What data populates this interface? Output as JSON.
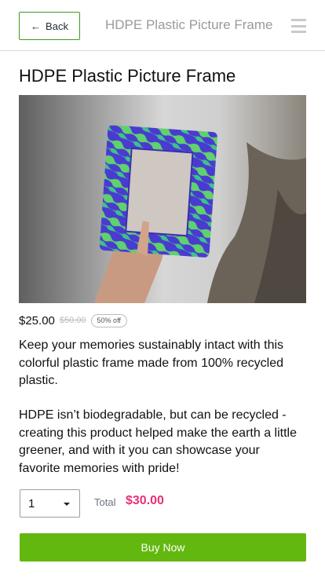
{
  "header": {
    "back_label": "Back",
    "title": "HDPE Plastic Picture Frame",
    "menu_icon": "hamburger-icon"
  },
  "product": {
    "title": "HDPE Plastic Picture Frame",
    "image_icon": "product-photo",
    "price_now": "$25.00",
    "price_was": "$50.00",
    "discount": "50% off",
    "description": [
      "Keep your memories sustainably intact with this colorful plastic frame made from 100% recycled plastic.",
      "HDPE isn’t biodegradable, but can be recycled - creating this product helped make the earth a little greener, and with it you can showcase your favorite memories with pride!"
    ]
  },
  "purchase": {
    "quantity": "1",
    "total_label": "Total",
    "total_value": "$30.00",
    "buy_label": "Buy Now"
  },
  "colors": {
    "accent_green": "#63b80f",
    "back_border": "#3f9a1e",
    "total_pink": "#e8307a"
  }
}
